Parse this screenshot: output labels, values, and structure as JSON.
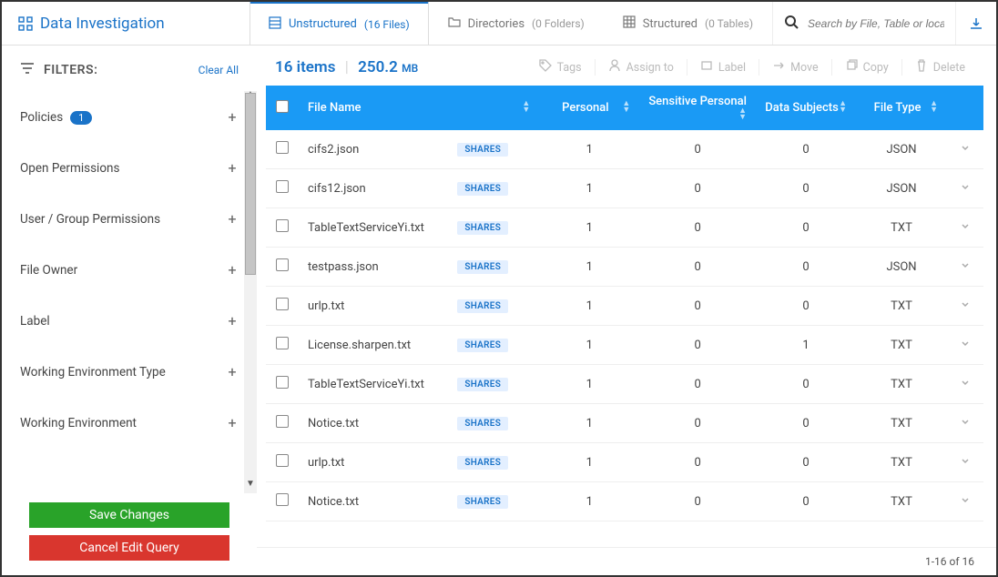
{
  "header": {
    "title": "Data Investigation",
    "tabs": [
      {
        "icon": "unstructured",
        "label": "Unstructured",
        "count": "(16 Files)",
        "active": true
      },
      {
        "icon": "directories",
        "label": "Directories",
        "count": "(0 Folders)",
        "active": false
      },
      {
        "icon": "structured",
        "label": "Structured",
        "count": "(0 Tables)",
        "active": false
      }
    ],
    "search_placeholder": "Search by File, Table or loca"
  },
  "sidebar": {
    "filters_label": "FILTERS:",
    "clear_all": "Clear All",
    "items": [
      {
        "label": "Policies",
        "badge": "1"
      },
      {
        "label": "Open Permissions"
      },
      {
        "label": "User / Group Permissions"
      },
      {
        "label": "File Owner"
      },
      {
        "label": "Label"
      },
      {
        "label": "Working Environment Type"
      },
      {
        "label": "Working Environment"
      }
    ],
    "save_label": "Save Changes",
    "cancel_label": "Cancel Edit Query"
  },
  "toolbar": {
    "items_count": "16 items",
    "size_value": "250.2",
    "size_unit": "MB",
    "actions": [
      {
        "icon": "tag",
        "label": "Tags"
      },
      {
        "icon": "assign",
        "label": "Assign to"
      },
      {
        "icon": "label",
        "label": "Label"
      },
      {
        "icon": "move",
        "label": "Move"
      },
      {
        "icon": "copy",
        "label": "Copy"
      },
      {
        "icon": "delete",
        "label": "Delete"
      }
    ]
  },
  "table": {
    "columns": [
      "File Name",
      "Personal",
      "Sensitive Personal",
      "Data Subjects",
      "File Type"
    ],
    "rows": [
      {
        "name": "cifs2.json",
        "tag": "SHARES",
        "personal": "1",
        "sensitive": "0",
        "subjects": "0",
        "type": "JSON"
      },
      {
        "name": "cifs12.json",
        "tag": "SHARES",
        "personal": "1",
        "sensitive": "0",
        "subjects": "0",
        "type": "JSON"
      },
      {
        "name": "TableTextServiceYi.txt",
        "tag": "SHARES",
        "personal": "1",
        "sensitive": "0",
        "subjects": "0",
        "type": "TXT"
      },
      {
        "name": "testpass.json",
        "tag": "SHARES",
        "personal": "1",
        "sensitive": "0",
        "subjects": "0",
        "type": "JSON"
      },
      {
        "name": "urlp.txt",
        "tag": "SHARES",
        "personal": "1",
        "sensitive": "0",
        "subjects": "0",
        "type": "TXT"
      },
      {
        "name": "License.sharpen.txt",
        "tag": "SHARES",
        "personal": "1",
        "sensitive": "0",
        "subjects": "1",
        "type": "TXT"
      },
      {
        "name": "TableTextServiceYi.txt",
        "tag": "SHARES",
        "personal": "1",
        "sensitive": "0",
        "subjects": "0",
        "type": "TXT"
      },
      {
        "name": "Notice.txt",
        "tag": "SHARES",
        "personal": "1",
        "sensitive": "0",
        "subjects": "0",
        "type": "TXT"
      },
      {
        "name": "urlp.txt",
        "tag": "SHARES",
        "personal": "1",
        "sensitive": "0",
        "subjects": "0",
        "type": "TXT"
      },
      {
        "name": "Notice.txt",
        "tag": "SHARES",
        "personal": "1",
        "sensitive": "0",
        "subjects": "0",
        "type": "TXT"
      }
    ]
  },
  "footer": {
    "pagination": "1-16 of 16"
  }
}
